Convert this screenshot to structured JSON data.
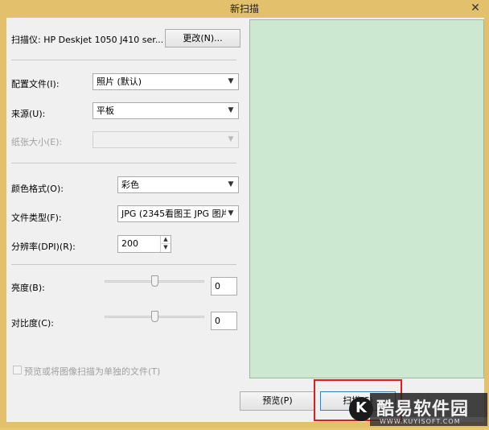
{
  "window": {
    "title": "新扫描",
    "close_glyph": "✕"
  },
  "scanner": {
    "label": "扫描仪: HP Deskjet 1050 J410 ser...",
    "change_button": "更改(N)..."
  },
  "profile": {
    "label": "配置文件(I):",
    "value": "照片 (默认)"
  },
  "source": {
    "label": "来源(U):",
    "value": "平板"
  },
  "paper_size": {
    "label": "纸张大小(E):",
    "value": ""
  },
  "color_format": {
    "label": "颜色格式(O):",
    "value": "彩色"
  },
  "file_type": {
    "label": "文件类型(F):",
    "value": "JPG (2345看图王 JPG 图片"
  },
  "resolution": {
    "label": "分辨率(DPI)(R):",
    "value": "200"
  },
  "brightness": {
    "label": "亮度(B):",
    "value": "0",
    "level_percent": 50
  },
  "contrast": {
    "label": "对比度(C):",
    "value": "0",
    "level_percent": 50
  },
  "separate_files": {
    "label": "预览或将图像扫描为单独的文件(T)",
    "checked": false
  },
  "buttons": {
    "preview": "预览(P)",
    "scan": "扫描(S)"
  },
  "watermark": {
    "brand": "酷易软件园",
    "url": "WWW.KUYISOFT.COM",
    "badge": "K"
  },
  "colors": {
    "preview_bg": "#cde8d0",
    "highlight": "#e51b1b",
    "frame": "#e3c16c"
  },
  "icons": {
    "dropdown": "chevron-down-icon",
    "spin_up": "triangle-up-icon",
    "spin_down": "triangle-down-icon"
  }
}
